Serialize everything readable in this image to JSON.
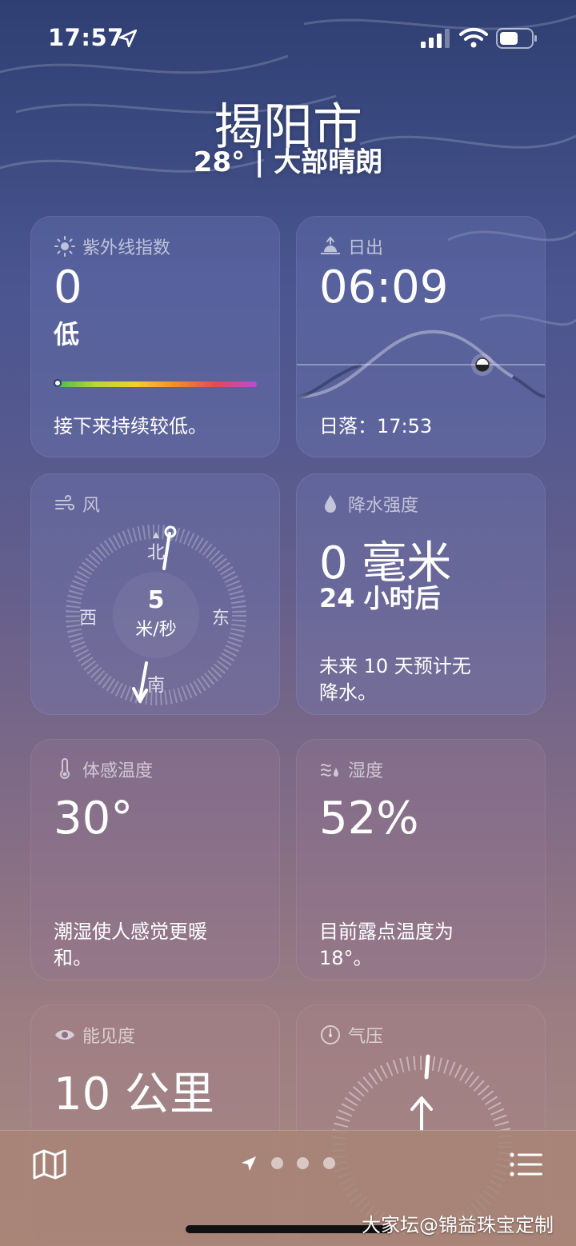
{
  "status_bar": {
    "time": "17:57"
  },
  "header": {
    "city": "揭阳市",
    "condition": "28° | 大部晴朗"
  },
  "cards": {
    "uv": {
      "title": "紫外线指数",
      "value": "0",
      "level": "低",
      "description": "接下来持续较低。",
      "index_fraction": 0
    },
    "sunrise": {
      "title": "日出",
      "time": "06:09",
      "sunset": "日落：17:53"
    },
    "wind": {
      "title": "风",
      "speed": "5",
      "unit": "米/秒",
      "north": "北",
      "east": "东",
      "south": "南",
      "west": "西"
    },
    "precip": {
      "title": "降水强度",
      "value": "0 毫米",
      "period": "24 小时后",
      "description": "未来 10 天预计无降水。"
    },
    "feels_like": {
      "title": "体感温度",
      "value": "30°",
      "description": "潮湿使人感觉更暖和。"
    },
    "humidity": {
      "title": "湿度",
      "value": "52%",
      "description": "目前露点温度为 18°。"
    },
    "visibility": {
      "title": "能见度",
      "value": "10 公里"
    },
    "pressure": {
      "title": "气压"
    }
  },
  "watermark": "大家坛@锦益珠宝定制"
}
